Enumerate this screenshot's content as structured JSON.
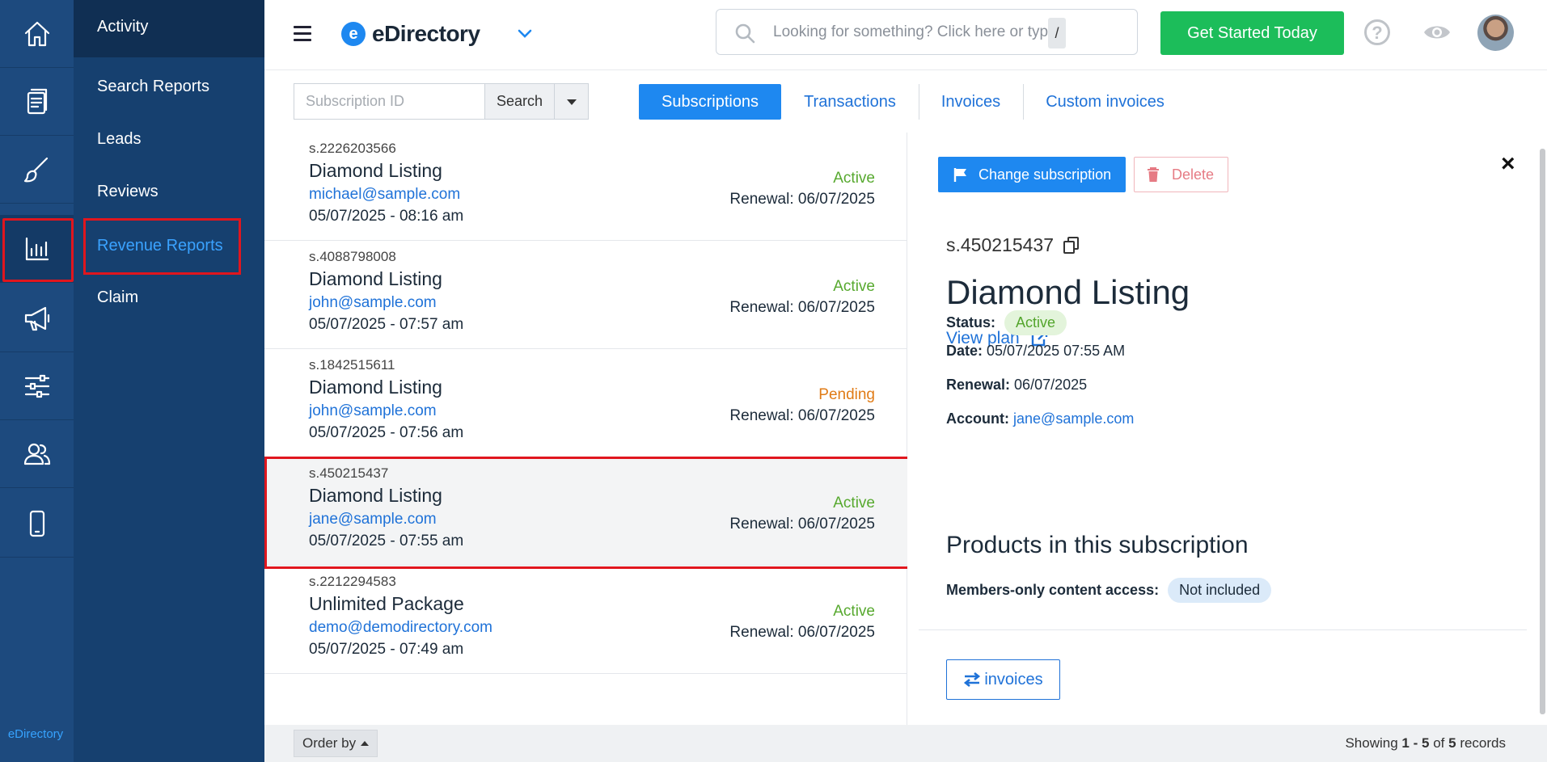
{
  "rail": {
    "brand": "eDirectory",
    "icons": [
      "home-icon",
      "document-icon",
      "brush-icon",
      "chart-icon",
      "megaphone-icon",
      "sliders-icon",
      "users-icon",
      "mobile-icon"
    ]
  },
  "submenu": {
    "items": [
      "Activity",
      "Search Reports",
      "Leads",
      "Reviews",
      "Revenue Reports",
      "Claim"
    ]
  },
  "header": {
    "logo_letter": "e",
    "logo_text": "eDirectory",
    "search_placeholder": "Looking for something? Click here or type",
    "search_shortcut": "/",
    "cta_label": "Get Started Today",
    "help_glyph": "?"
  },
  "toolbar": {
    "subscription_placeholder": "Subscription ID",
    "search_label": "Search",
    "tabs": [
      "Subscriptions",
      "Transactions",
      "Invoices",
      "Custom invoices"
    ]
  },
  "subscriptions": [
    {
      "id": "s.2226203566",
      "plan": "Diamond Listing",
      "email": "michael@sample.com",
      "date": "05/07/2025 - 08:16 am",
      "status": "Active",
      "renewal": "Renewal: 06/07/2025"
    },
    {
      "id": "s.4088798008",
      "plan": "Diamond Listing",
      "email": "john@sample.com",
      "date": "05/07/2025 - 07:57 am",
      "status": "Active",
      "renewal": "Renewal: 06/07/2025"
    },
    {
      "id": "s.1842515611",
      "plan": "Diamond Listing",
      "email": "john@sample.com",
      "date": "05/07/2025 - 07:56 am",
      "status": "Pending",
      "renewal": "Renewal: 06/07/2025"
    },
    {
      "id": "s.450215437",
      "plan": "Diamond Listing",
      "email": "jane@sample.com",
      "date": "05/07/2025 - 07:55 am",
      "status": "Active",
      "renewal": "Renewal: 06/07/2025"
    },
    {
      "id": "s.2212294583",
      "plan": "Unlimited Package",
      "email": "demo@demodirectory.com",
      "date": "05/07/2025 - 07:49 am",
      "status": "Active",
      "renewal": "Renewal: 06/07/2025"
    }
  ],
  "detail": {
    "change_label": "Change subscription",
    "delete_label": "Delete",
    "close_glyph": "×",
    "id": "s.450215437",
    "plan": "Diamond Listing",
    "view_plan": "View plan",
    "status_label": "Status:",
    "status_value": "Active",
    "date_label": "Date:",
    "date_value": "05/07/2025 07:55 AM",
    "renewal_label": "Renewal:",
    "renewal_value": "06/07/2025",
    "account_label": "Account:",
    "account_value": "jane@sample.com",
    "products_heading": "Products in this subscription",
    "members_label": "Members-only content access:",
    "members_value": "Not included",
    "invoices_label": "invoices"
  },
  "footer": {
    "order_label": "Order by",
    "showing_prefix": "Showing",
    "showing_range": "1 - 5",
    "showing_of": "of",
    "showing_total": "5",
    "showing_suffix": "records"
  },
  "colors": {
    "rail": "#1d4a7e",
    "submenu": "#16406f",
    "accent": "#1e88f0",
    "cta": "#1cbd5a",
    "highlight": "#e0161e"
  }
}
